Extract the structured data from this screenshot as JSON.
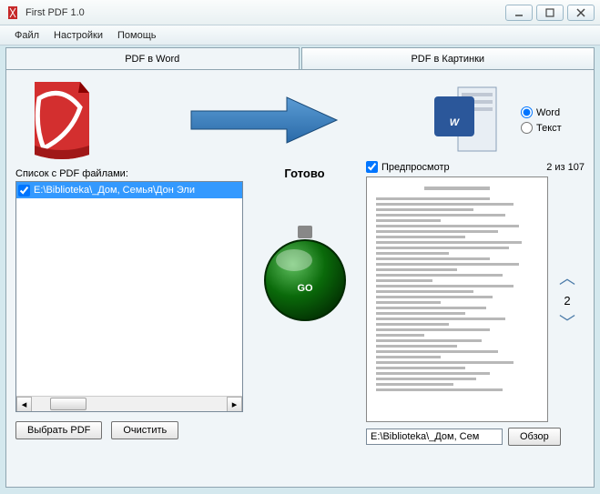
{
  "window": {
    "title": "First PDF 1.0"
  },
  "menu": {
    "file": "Файл",
    "settings": "Настройки",
    "help": "Помощь"
  },
  "tabs": {
    "word": "PDF в Word",
    "images": "PDF в Картинки"
  },
  "format": {
    "word": "Word",
    "text": "Текст"
  },
  "filelist": {
    "label": "Список с PDF файлами:",
    "items": [
      "E:\\Biblioteka\\_Дом, Семья\\Дон Эли"
    ]
  },
  "status": "Готово",
  "buttons": {
    "selectPdf": "Выбрать PDF",
    "clear": "Очистить",
    "browse": "Обзор"
  },
  "preview": {
    "label": "Предпросмотр",
    "counter": "2 из 107",
    "currentPage": "2"
  },
  "output": {
    "path": "E:\\Biblioteka\\_Дом, Сем"
  }
}
